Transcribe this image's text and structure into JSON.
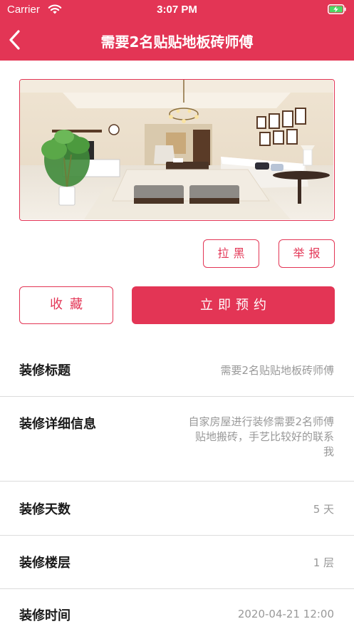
{
  "status_bar": {
    "carrier": "Carrier",
    "time": "3:07 PM",
    "wifi_icon": "wifi-icon",
    "battery_icon": "battery-charging-icon"
  },
  "nav": {
    "back_icon": "chevron-left-icon",
    "title": "需要2名贴贴地板砖师傅"
  },
  "hero_image": {
    "subject": "living-room-photo"
  },
  "actions": {
    "block_label": "拉黑",
    "report_label": "举报",
    "favorite_label": "收藏",
    "book_label": "立即预约"
  },
  "details": [
    {
      "label": "装修标题",
      "value": "需要2名贴贴地板砖师傅"
    },
    {
      "label": "装修详细信息",
      "value_lines": [
        "自家房屋进行装修需要2名师傅",
        "贴地搬砖，手艺比较好的联系",
        "我"
      ]
    },
    {
      "label": "装修天数",
      "value": "5 天"
    },
    {
      "label": "装修楼层",
      "value": "1 层"
    },
    {
      "label": "装修时间",
      "value": "2020-04-21 12:00"
    }
  ],
  "colors": {
    "accent": "#e33555",
    "label_text": "#1a1a1a",
    "value_text": "#999999",
    "divider": "#dcdcdc"
  }
}
